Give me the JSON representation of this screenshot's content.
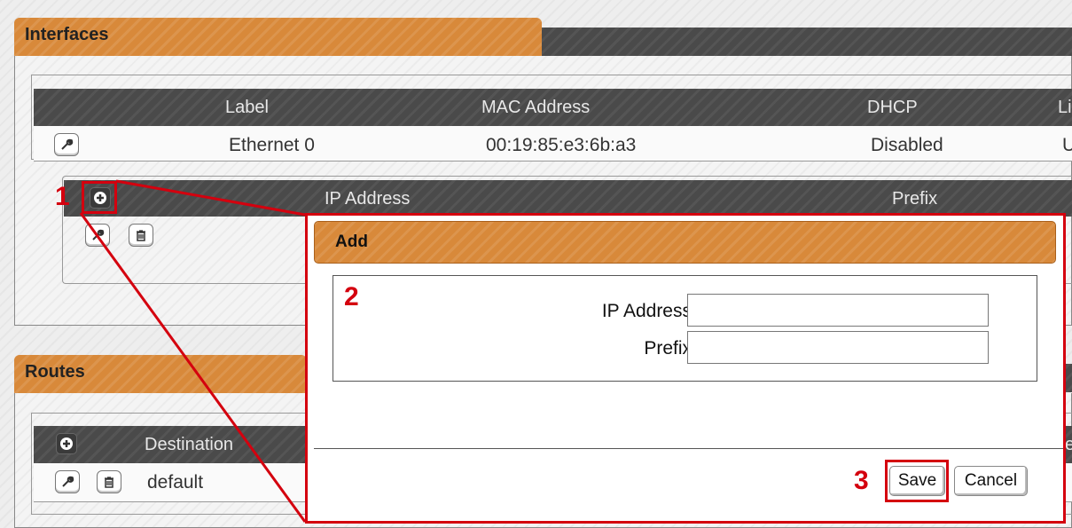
{
  "interfaces": {
    "title": "Interfaces",
    "columns": [
      "Label",
      "MAC Address",
      "DHCP",
      "Li"
    ],
    "rows": [
      {
        "label": "Ethernet 0",
        "mac": "00:19:85:e3:6b:a3",
        "dhcp": "Disabled",
        "link": "U"
      }
    ],
    "ip_subtable": {
      "columns": [
        "IP Address",
        "Prefix"
      ]
    }
  },
  "routes": {
    "title": "Routes",
    "columns": [
      "Destination",
      "e"
    ],
    "rows": [
      {
        "destination": "default"
      }
    ]
  },
  "dialog": {
    "title": "Add",
    "fields": [
      {
        "label": "IP Address",
        "value": "",
        "placeholder": ""
      },
      {
        "label": "Prefix",
        "value": "",
        "placeholder": ""
      }
    ],
    "save_label": "Save",
    "cancel_label": "Cancel"
  },
  "annotations": {
    "step1": "1",
    "step2": "2",
    "step3": "3",
    "color": "#d4000e"
  },
  "colors": {
    "accent": "#d8893a",
    "header_dark": "#4a4a4a"
  },
  "icons": {
    "edit": "wrench-icon",
    "delete": "trash-icon",
    "add": "plus-circle-icon"
  }
}
